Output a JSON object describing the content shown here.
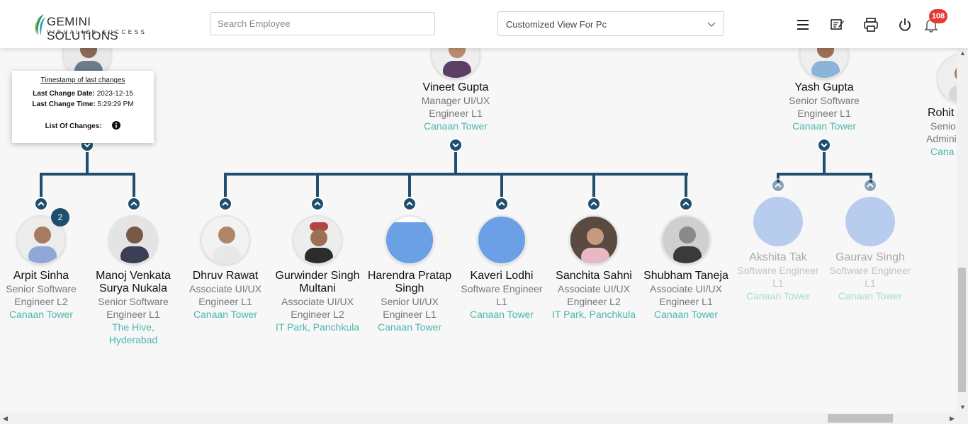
{
  "header": {
    "logo_name": "GEMINI SOLUTIONS",
    "logo_tagline": "VISUALIZE SUCCESS",
    "search_placeholder": "Search Employee",
    "view_select_value": "Customized View For Pc",
    "notification_count": "108",
    "icons": [
      "menu-icon",
      "edit-note-icon",
      "print-icon",
      "power-icon",
      "bell-icon"
    ]
  },
  "tooltip": {
    "title": "Timestamp of last changes",
    "date_label": "Last Change Date:",
    "date_value": "2023-12-15",
    "time_label": "Last Change Time:",
    "time_value": "5:29:29 PM",
    "changes_label": "List Of Changes:"
  },
  "managers": [
    {
      "name": "Vineet Gupta",
      "role": "Manager UI/UX Engineer L1",
      "location": "Canaan Tower"
    },
    {
      "name": "Yash Gupta",
      "role": "Senior Software Engineer L1",
      "location": "Canaan Tower"
    },
    {
      "name": "Rohit",
      "role": "Senio",
      "role2": "Admini",
      "location": "Cana"
    }
  ],
  "reports": [
    {
      "name": "Arpit Sinha",
      "role": "Senior Software Engineer L2",
      "location": "Canaan Tower",
      "count": "2"
    },
    {
      "name": "Manoj Venkata Surya Nukala",
      "role": "Senior Software Engineer L1",
      "location": "The Hive, Hyderabad"
    },
    {
      "name": "Dhruv Rawat",
      "role": "Associate UI/UX Engineer L1",
      "location": "Canaan Tower"
    },
    {
      "name": "Gurwinder Singh Multani",
      "role": "Associate UI/UX Engineer L2",
      "location": "IT Park, Panchkula"
    },
    {
      "name": "Harendra Pratap Singh",
      "role": "Senior UI/UX Engineer L1",
      "location": "Canaan Tower"
    },
    {
      "name": "Kaveri Lodhi",
      "role": "Software Engineer L1",
      "location": "Canaan Tower"
    },
    {
      "name": "Sanchita Sahni",
      "role": "Associate UI/UX Engineer L2",
      "location": "IT Park, Panchkula"
    },
    {
      "name": "Shubham Taneja",
      "role": "Associate UI/UX Engineer L1",
      "location": "Canaan Tower"
    },
    {
      "name": "Akshita Tak",
      "role": "Software Engineer L1",
      "location": "Canaan Tower"
    },
    {
      "name": "Gaurav Singh",
      "role": "Software Engineer L1",
      "location": "Canaan Tower"
    }
  ],
  "colors": {
    "accent": "#1f4e6e",
    "location": "#4db6ac",
    "badge": "#e53935"
  }
}
